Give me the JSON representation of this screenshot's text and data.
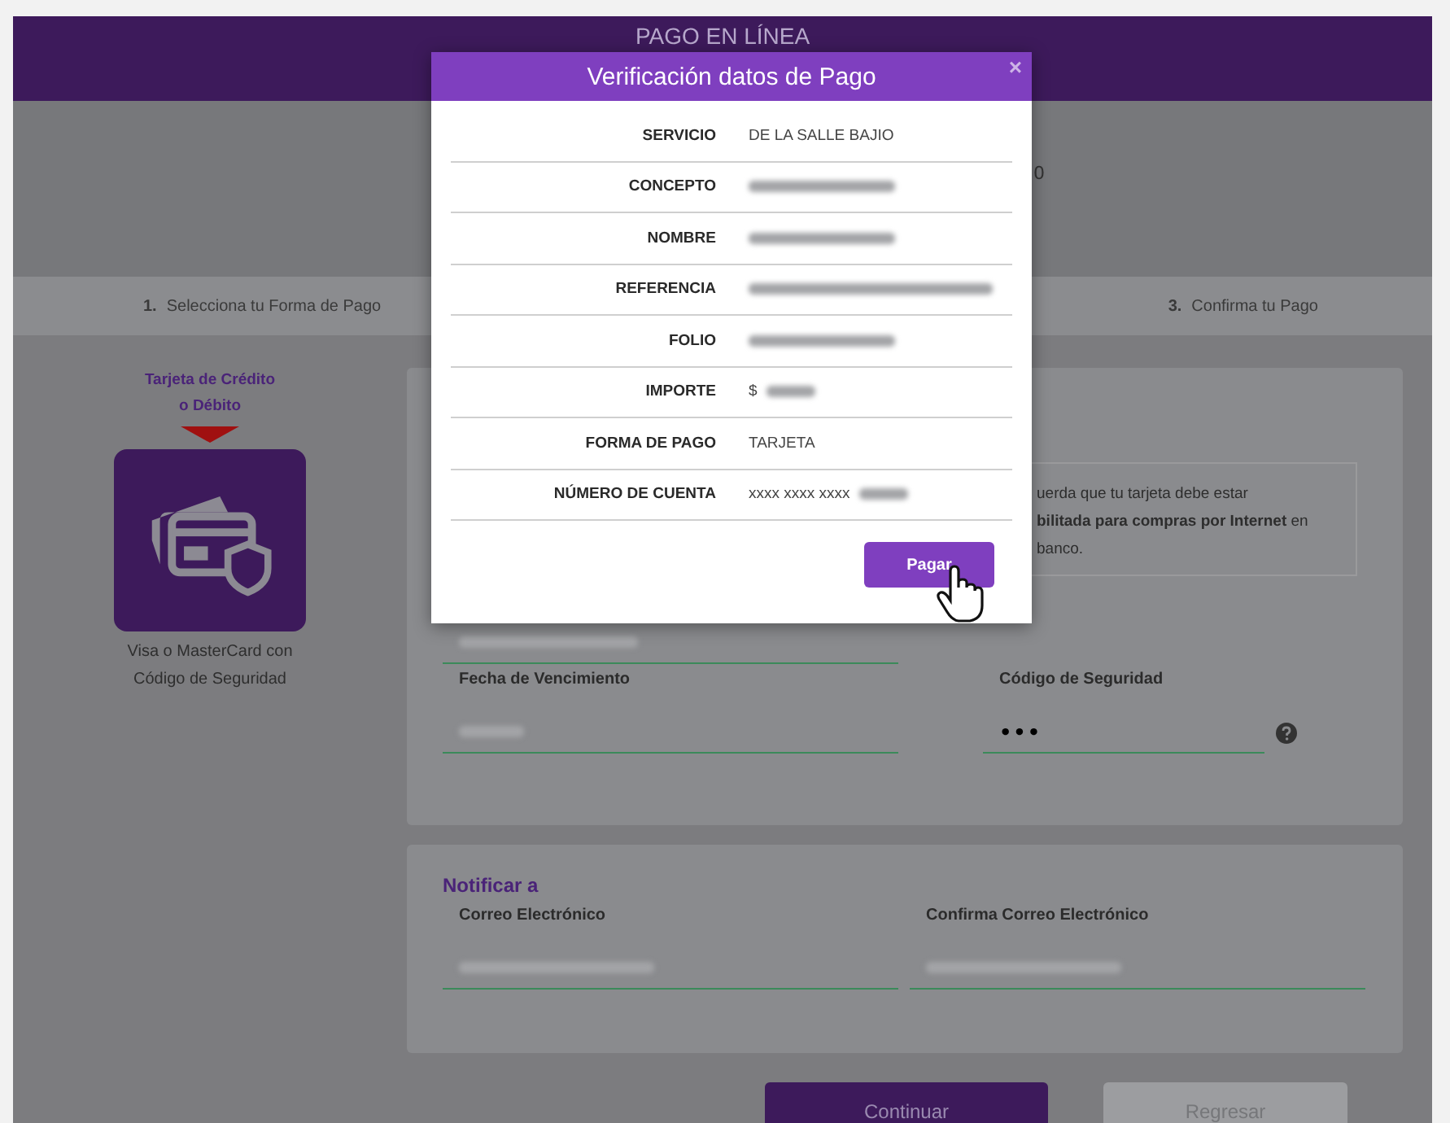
{
  "header": {
    "title": "PAGO EN LÍNEA"
  },
  "banner": {
    "fragment": "0"
  },
  "steps": [
    {
      "number": "1.",
      "label": "Selecciona tu Forma de Pago"
    },
    {
      "number": "3.",
      "label": "Confirma tu Pago"
    }
  ],
  "payment_option": {
    "title": "Tarjeta de Crédito o Débito",
    "caption": "Visa o MasterCard con Código de Seguridad"
  },
  "card_form": {
    "note_lines": [
      "uerda que tu tarjeta debe estar",
      "**bilitada para compras por Internet** en",
      "banco."
    ],
    "fields": [
      {
        "label": "Fecha de Vencimiento",
        "kind": "blurred"
      },
      {
        "label": "Código de Seguridad",
        "value": "•••",
        "kind": "secret"
      }
    ]
  },
  "notify": {
    "title": "Notificar a",
    "fields": [
      {
        "label": "Correo Electrónico"
      },
      {
        "label": "Confirma Correo Electrónico"
      }
    ]
  },
  "buttons": [
    {
      "label": "Continuar",
      "kind": "primary"
    },
    {
      "label": "Regresar",
      "kind": "secondary"
    }
  ],
  "modal": {
    "title": "Verificación datos de Pago",
    "close": "×",
    "rows": [
      {
        "label": "SERVICIO",
        "value": "DE LA SALLE BAJIO"
      },
      {
        "label": "CONCEPTO"
      },
      {
        "label": "NOMBRE"
      },
      {
        "label": "REFERENCIA"
      },
      {
        "label": "FOLIO"
      },
      {
        "label": "IMPORTE",
        "value": "$"
      },
      {
        "label": "FORMA DE PAGO",
        "value": "TARJETA"
      },
      {
        "label": "NÚMERO DE CUENTA",
        "value": "xxxx xxxx xxxx"
      }
    ],
    "button": "Pagar"
  }
}
